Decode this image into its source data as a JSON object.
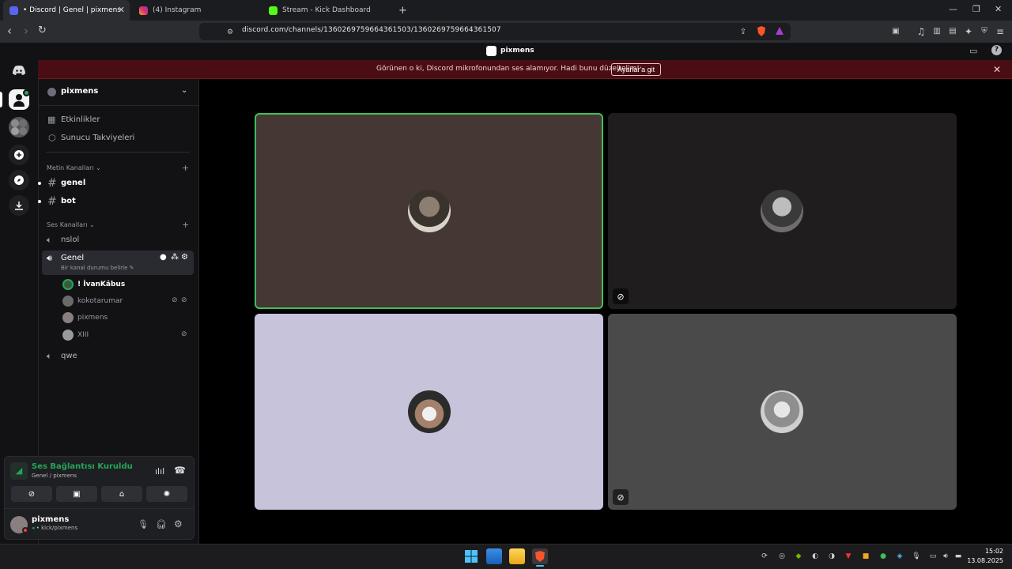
{
  "browser": {
    "tabs": [
      {
        "label": "• Discord | Genel | pixmens",
        "active": true
      },
      {
        "label": "(4) Instagram",
        "active": false
      },
      {
        "label": "Stream - Kick Dashboard",
        "active": false
      }
    ],
    "new_tab": "+",
    "url": "discord.com/channels/1360269759664361503/1360269759664361507"
  },
  "discord": {
    "title": "pixmens",
    "banner": {
      "message": "Görünen o ki, Discord mikrofonundan ses alamıyor. Hadi bunu düzeltelim!",
      "button": "Ayarlar'a git"
    },
    "server_name": "pixmens",
    "nav": {
      "events": "Etkinlikler",
      "boosts": "Sunucu Takviyeleri"
    },
    "text_category": "Metin Kanalları",
    "text_channels": [
      "genel",
      "bot"
    ],
    "voice_category": "Ses Kanalları",
    "voice_channels": {
      "first": "nslol",
      "active": "Genel",
      "active_status": "Bir kanal durumu belirle",
      "last": "qwe"
    },
    "voice_users": [
      "! İvanKâbus",
      "kokotarumar",
      "pixmens",
      "XIII"
    ],
    "voice_panel": {
      "status": "Ses Bağlantısı Kuruldu",
      "location": "Genel / pixmens"
    },
    "user": {
      "name": "pixmens",
      "status": "• kick/pixmens"
    }
  },
  "tiles": [
    {
      "bg": "#453834",
      "speaking": true,
      "muted": false
    },
    {
      "bg": "#1f1d1e",
      "speaking": false,
      "muted": true
    },
    {
      "bg": "#c6c3da",
      "speaking": false,
      "muted": false
    },
    {
      "bg": "#4a4a4a",
      "speaking": false,
      "muted": true
    }
  ],
  "taskbar": {
    "time": "15:02",
    "date": "13.08.2025"
  },
  "colors": {
    "accent_green": "#23a55a",
    "banner_red": "#4a0d14",
    "speaking_border": "#3fbf5a"
  }
}
